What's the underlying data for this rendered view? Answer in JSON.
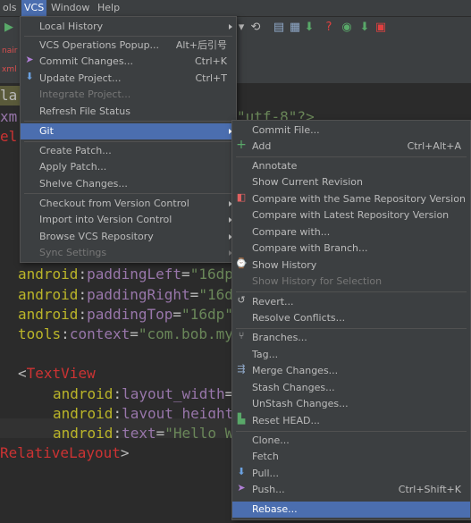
{
  "menubar": {
    "items": [
      {
        "label": "ols"
      },
      {
        "label": "VCS"
      },
      {
        "label": "Window"
      },
      {
        "label": "Help"
      }
    ]
  },
  "tabs": {
    "fragment1": "nair",
    "fragment2": "xml"
  },
  "editor": {
    "line_la": "la",
    "line_xm": "xm",
    "line_el": "el",
    "encoding": "\"utf-8\"?>",
    "lines": [
      {
        "attr": "paddingLeft",
        "val": "\"16dp"
      },
      {
        "attr": "paddingRight",
        "val": "\"16d"
      },
      {
        "attr": "paddingTop",
        "val": "\"16dp\""
      },
      {
        "prefix": "tools",
        "attr": "context",
        "val": "\"com.bob.my"
      }
    ],
    "android": "android",
    "textview": "TextView",
    "tv_attrs": [
      {
        "attr": "layout_width",
        "val": ""
      },
      {
        "attr": "layout_height",
        "val": ""
      },
      {
        "attr": "text",
        "val": "\"Hello W"
      }
    ],
    "closing": "RelativeLayout"
  },
  "vcs_menu": {
    "items": [
      {
        "label": "Local History",
        "submenu": true
      },
      {
        "label": "VCS Operations Popup...",
        "shortcut": "Alt+后引号"
      },
      {
        "label": "Commit Changes...",
        "shortcut": "Ctrl+K"
      },
      {
        "label": "Update Project...",
        "shortcut": "Ctrl+T"
      },
      {
        "label": "Integrate Project...",
        "disabled": true
      },
      {
        "label": "Refresh File Status"
      },
      {
        "label": "Git",
        "submenu": true,
        "selected": true
      },
      {
        "label": "Create Patch..."
      },
      {
        "label": "Apply Patch..."
      },
      {
        "label": "Shelve Changes..."
      },
      {
        "label": "Checkout from Version Control",
        "submenu": true
      },
      {
        "label": "Import into Version Control",
        "submenu": true
      },
      {
        "label": "Browse VCS Repository",
        "submenu": true
      },
      {
        "label": "Sync Settings",
        "submenu": true,
        "disabled": true
      }
    ]
  },
  "git_menu": {
    "items": [
      {
        "label": "Commit File..."
      },
      {
        "label": "Add",
        "shortcut": "Ctrl+Alt+A"
      },
      {
        "label": "Annotate"
      },
      {
        "label": "Show Current Revision"
      },
      {
        "label": "Compare with the Same Repository Version"
      },
      {
        "label": "Compare with Latest Repository Version"
      },
      {
        "label": "Compare with..."
      },
      {
        "label": "Compare with Branch..."
      },
      {
        "label": "Show History"
      },
      {
        "label": "Show History for Selection",
        "disabled": true
      },
      {
        "label": "Revert..."
      },
      {
        "label": "Resolve Conflicts..."
      },
      {
        "label": "Branches..."
      },
      {
        "label": "Tag..."
      },
      {
        "label": "Merge Changes..."
      },
      {
        "label": "Stash Changes..."
      },
      {
        "label": "UnStash Changes..."
      },
      {
        "label": "Reset HEAD..."
      },
      {
        "label": "Clone..."
      },
      {
        "label": "Fetch"
      },
      {
        "label": "Pull..."
      },
      {
        "label": "Push...",
        "shortcut": "Ctrl+Shift+K"
      },
      {
        "label": "Rebase...",
        "selected": true
      }
    ]
  },
  "colors": {
    "selection": "#4b6eaf",
    "menu_bg": "#3c3f41",
    "editor_bg": "#2b2b2b"
  }
}
